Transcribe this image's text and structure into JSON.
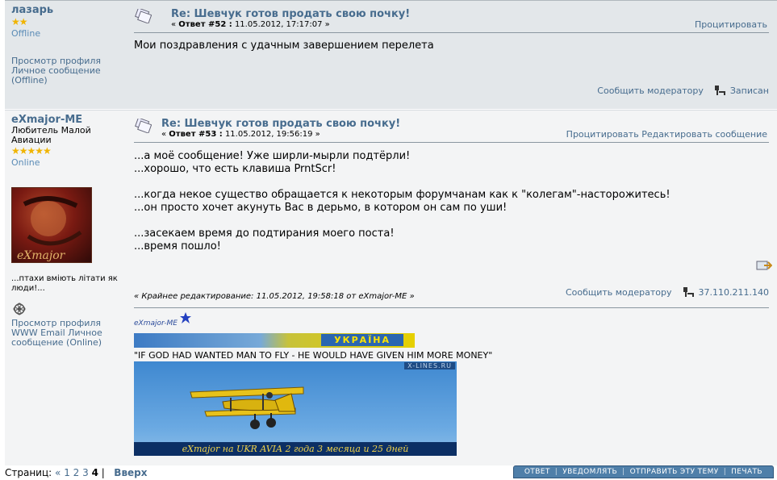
{
  "post1": {
    "author": "лазарь",
    "stars": "★★",
    "status": "Offline",
    "links": [
      "Просмотр профиля",
      "Личное сообщение",
      "(Offline)"
    ],
    "title": "Re: Шевчук готов продать свою почку!",
    "meta_prefix": "« ",
    "reply_label": "Ответ #52 :",
    "date": " 11.05.2012, 17:17:07 »",
    "action_quote": "Процитировать",
    "body": "Мои поздравления с удачным завершением перелета",
    "report": "Сообщить модератору",
    "logged": "Записан"
  },
  "post2": {
    "author": "eXmajor-ME",
    "group": "Любитель Малой Авиации",
    "stars": "★★★★★",
    "status": "Online",
    "avatar_text": "eXmajor",
    "personal_text": "...птахи вміють літати як люди!...",
    "links": [
      "Просмотр профиля",
      "WWW Email Личное сообщение (Online)"
    ],
    "title": "Re: Шевчук готов продать свою почку!",
    "meta_prefix": "« ",
    "reply_label": "Ответ #53 :",
    "date": " 11.05.2012, 19:56:19 »",
    "action_quote": "Процитировать",
    "action_edit": "Редактировать сообщение",
    "body_lines": [
      "...а моё сообщение! Уже ширли-мырли подтёрли!",
      "...хорошо, что есть клавиша PrntScr!",
      "",
      "...когда некое существо обращается к некоторым форумчанам как к \"колегам\"-насторожитесь!",
      "...он просто хочет акунуть Вас в дерьмо, в котором он сам по уши!",
      "",
      "...засекаем время до подтирания моего поста!",
      "...время пошло!"
    ],
    "edit_note": "« Крайнее редактирование: 11.05.2012, 19:58:18 от eXmajor-ME »",
    "report": "Сообщить модератору",
    "ip": "37.110.211.140",
    "sig_logo": "eXmajor-ME",
    "sig_banner": "УКРАЇНА",
    "sig_quote": "\"IF GOD HAD WANTED MAN TO FLY - HE WOULD HAVE GIVEN HIM MORE MONEY\"",
    "sig_site": "X-LINES.RU",
    "sig_caption": "eXmajor на UKR AVIA 2 года 3 месяца и 25 дней"
  },
  "pager": {
    "label": "Страниц:",
    "prev": "«",
    "pages": [
      "1",
      "2",
      "3"
    ],
    "current": "4",
    "sep": "|",
    "up": "Вверх"
  },
  "buttons": [
    "ОТВЕТ",
    "УВЕДОМЛЯТЬ",
    "ОТПРАВИТЬ ЭТУ ТЕМУ",
    "ПЕЧАТЬ"
  ]
}
